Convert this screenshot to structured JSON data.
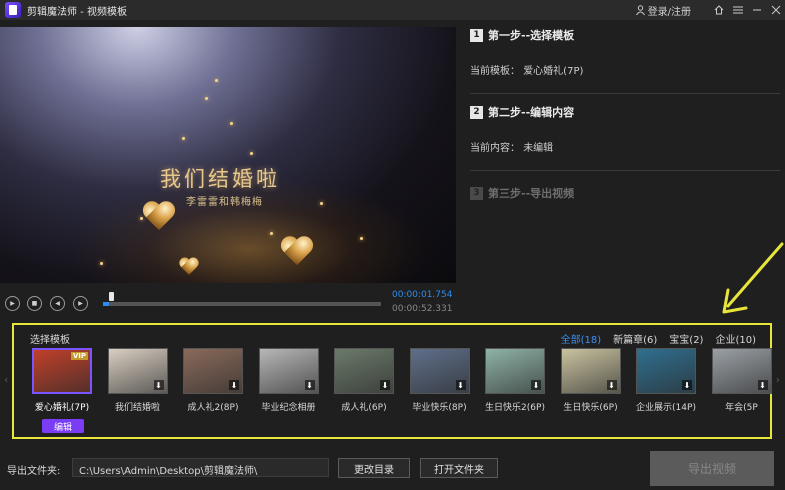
{
  "app": {
    "title": "剪辑魔法师 - 视频模板",
    "login": "登录/注册"
  },
  "player": {
    "title_line1": "我们结婚啦",
    "title_line2": "李雷雷和韩梅梅",
    "current_time": "00:00:01.754",
    "total_time": "00:00:52.331",
    "progress": 0.02
  },
  "steps": {
    "step1": {
      "num": "1",
      "title": "第一步--选择模板",
      "key": "当前模板：",
      "value": "爱心婚礼(7P)"
    },
    "step2": {
      "num": "2",
      "title": "第二步--编辑内容",
      "key": "当前内容：",
      "value": "未编辑"
    },
    "step3": {
      "num": "3",
      "title": "第三步--导出视频"
    }
  },
  "templates": {
    "label": "选择模板",
    "filters": [
      "全部(18)",
      "新篇章(6)",
      "宝宝(2)",
      "企业(10)"
    ],
    "active_filter": "全部(18)",
    "edit_label": "编辑",
    "vip_label": "VIP",
    "items": [
      {
        "name": "爱心婚礼(7P)",
        "color": "#c0402a"
      },
      {
        "name": "我们结婚啦",
        "color": "#d9cfc2"
      },
      {
        "name": "成人礼2(8P)",
        "color": "#8a6a5a"
      },
      {
        "name": "毕业纪念相册",
        "color": "#b7b7b7"
      },
      {
        "name": "成人礼(6P)",
        "color": "#6b7a6a"
      },
      {
        "name": "毕业快乐(8P)",
        "color": "#5f6f8a"
      },
      {
        "name": "生日快乐2(6P)",
        "color": "#8fb3a6"
      },
      {
        "name": "生日快乐(6P)",
        "color": "#c9c2a0"
      },
      {
        "name": "企业展示(14P)",
        "color": "#2f6f8f"
      },
      {
        "name": "年会(5P",
        "color": "#9aa0a5"
      }
    ]
  },
  "bottom": {
    "output_label": "导出文件夹:",
    "output_path": "C:\\Users\\Admin\\Desktop\\剪辑魔法师\\",
    "change_dir": "更改目录",
    "open_folder": "打开文件夹",
    "export": "导出视频"
  },
  "colors": {
    "accent": "#2d8cf0",
    "highlight_border": "#e9e63b",
    "edit_button": "#7a3df5"
  }
}
